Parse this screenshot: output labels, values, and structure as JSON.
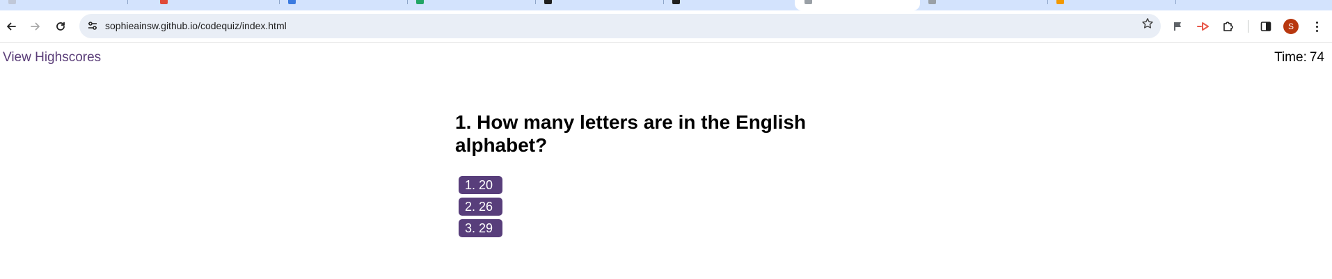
{
  "browser": {
    "url": "sophieainsw.github.io/codequiz/index.html",
    "profile_initial": "S",
    "colors": {
      "tabstrip": "#d3e3fd",
      "omnibox": "#e9eef6",
      "avatar": "#b8370f"
    },
    "tabs": [
      {
        "favicon_color": "#c0c8d8"
      },
      {
        "favicon_color": "#e04a3a"
      },
      {
        "favicon_color": "#3b7be0"
      },
      {
        "favicon_color": "#22a565"
      },
      {
        "favicon_color": "#1f1f1f"
      },
      {
        "favicon_color": "#1f1f1f"
      },
      {
        "favicon_color": "#9aa0a6"
      },
      {
        "favicon_color": "#9aa0a6"
      },
      {
        "favicon_color": "#f29900"
      }
    ]
  },
  "page": {
    "highscores_link": "View Highscores",
    "timer_label": "Time:",
    "timer_value": "74",
    "question": "1. How many letters are in the English alphabet?",
    "choices": [
      "1. 20",
      "2. 26",
      "3. 29"
    ],
    "colors": {
      "link": "#5a3d78",
      "choice_bg": "#583e7b",
      "choice_text": "#ffffff"
    }
  }
}
